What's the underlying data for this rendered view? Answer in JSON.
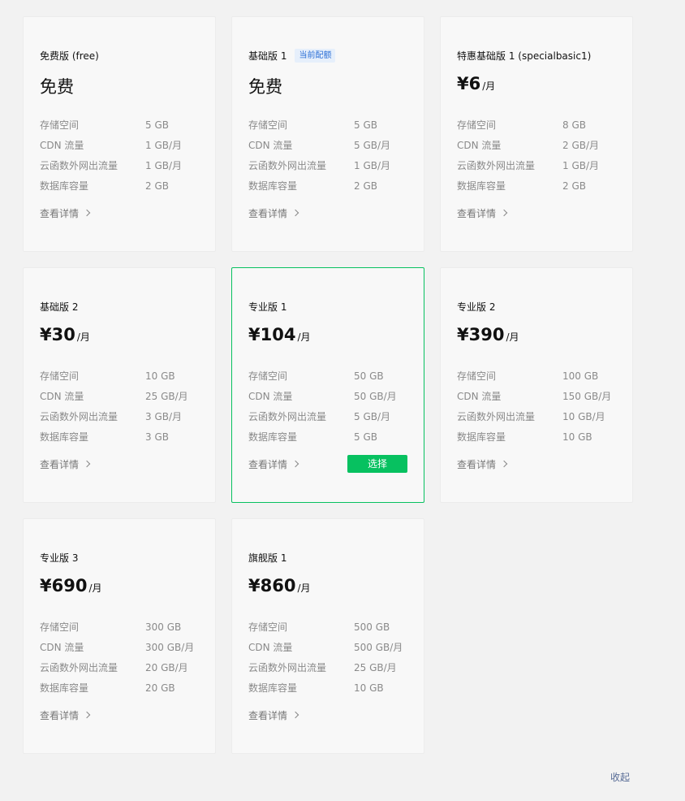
{
  "spec_labels": [
    "存储空间",
    "CDN 流量",
    "云函数外网出流量",
    "数据库容量"
  ],
  "detail_label": "查看详情",
  "select_label": "选择",
  "badge_current": "当前配额",
  "collapse_label": "收起",
  "plans": [
    {
      "title": "免费版 (free)",
      "price": "免费",
      "unit": "",
      "specs": [
        "5 GB",
        "1 GB/月",
        "1 GB/月",
        "2 GB"
      ]
    },
    {
      "title": "基础版 1",
      "price": "免费",
      "unit": "",
      "specs": [
        "5 GB",
        "5 GB/月",
        "1 GB/月",
        "2 GB"
      ]
    },
    {
      "title": "特惠基础版 1 (specialbasic1)",
      "price": "¥6",
      "unit": "/月",
      "specs": [
        "8 GB",
        "2 GB/月",
        "1 GB/月",
        "2 GB"
      ]
    },
    {
      "title": "基础版 2",
      "price": "¥30",
      "unit": "/月",
      "specs": [
        "10 GB",
        "25 GB/月",
        "3 GB/月",
        "3 GB"
      ]
    },
    {
      "title": "专业版 1",
      "price": "¥104",
      "unit": "/月",
      "specs": [
        "50 GB",
        "50 GB/月",
        "5 GB/月",
        "5 GB"
      ]
    },
    {
      "title": "专业版 2",
      "price": "¥390",
      "unit": "/月",
      "specs": [
        "100 GB",
        "150 GB/月",
        "10 GB/月",
        "10 GB"
      ]
    },
    {
      "title": "专业版 3",
      "price": "¥690",
      "unit": "/月",
      "specs": [
        "300 GB",
        "300 GB/月",
        "20 GB/月",
        "20 GB"
      ]
    },
    {
      "title": "旗舰版 1",
      "price": "¥860",
      "unit": "/月",
      "specs": [
        "500 GB",
        "500 GB/月",
        "25 GB/月",
        "10 GB"
      ]
    }
  ],
  "colors": {
    "accent": "#07c160",
    "badge_text": "#2b6fd6",
    "link": "#576b95"
  }
}
